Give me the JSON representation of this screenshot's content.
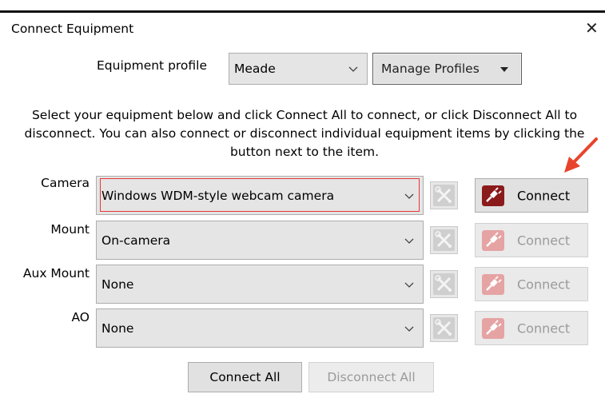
{
  "window": {
    "title": "Connect Equipment",
    "close_glyph": "✕"
  },
  "profile": {
    "label": "Equipment profile",
    "selected": "Meade",
    "manage_label": "Manage Profiles"
  },
  "instructions": "Select your equipment below and click Connect All to connect, or click Disconnect All to disconnect. You can also connect or disconnect individual equipment items by clicking the button next to the item.",
  "equipment": [
    {
      "label": "Camera",
      "value": "Windows WDM-style webcam camera",
      "connect_label": "Connect",
      "highlighted": true,
      "connect_enabled": true
    },
    {
      "label": "Mount",
      "value": "On-camera",
      "connect_label": "Connect",
      "highlighted": false,
      "connect_enabled": false
    },
    {
      "label": "Aux Mount",
      "value": "None",
      "connect_label": "Connect",
      "highlighted": false,
      "connect_enabled": false
    },
    {
      "label": "AO",
      "value": "None",
      "connect_label": "Connect",
      "highlighted": false,
      "connect_enabled": false
    }
  ],
  "footer": {
    "connect_all_label": "Connect All",
    "disconnect_all_label": "Disconnect All"
  },
  "colors": {
    "highlight_border": "#e53935",
    "arrow": "#e8442d",
    "plug_active": "#8b1a1a",
    "plug_disabled": "#e6a3a3",
    "disabled_text": "#9a9a9a"
  },
  "icons": {
    "close": "close-icon",
    "chevron": "chevron-down-icon",
    "caret": "caret-down-icon",
    "tools": "tools-icon",
    "plug": "plug-icon",
    "arrow": "annotation-arrow-icon"
  }
}
